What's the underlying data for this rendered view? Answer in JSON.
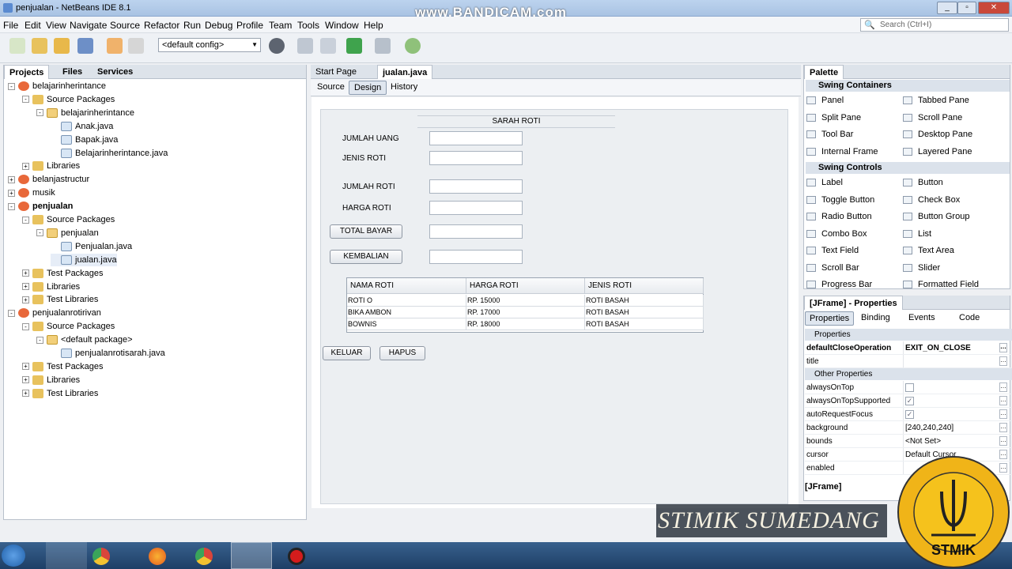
{
  "window": {
    "title": "penjualan - NetBeans IDE 8.1",
    "recorder_watermark": "www.BANDICAM.com",
    "controls": [
      "_",
      "▫",
      "✕"
    ]
  },
  "menu": [
    "File",
    "Edit",
    "View",
    "Navigate",
    "Source",
    "Refactor",
    "Run",
    "Debug",
    "Profile",
    "Team",
    "Tools",
    "Window",
    "Help"
  ],
  "search": {
    "placeholder": "Search (Ctrl+I)"
  },
  "toolbar": {
    "config": "<default config>"
  },
  "projects_panel": {
    "tabs": [
      "Projects",
      "Files",
      "Services"
    ],
    "tree": [
      {
        "label": "belajarinherintance",
        "level": 0,
        "icon": "project",
        "exp": "-"
      },
      {
        "label": "Source Packages",
        "level": 1,
        "icon": "folder",
        "exp": "-"
      },
      {
        "label": "belajarinherintance",
        "level": 2,
        "icon": "package",
        "exp": "-"
      },
      {
        "label": "Anak.java",
        "level": 3,
        "icon": "java"
      },
      {
        "label": "Bapak.java",
        "level": 3,
        "icon": "java"
      },
      {
        "label": "Belajarinherintance.java",
        "level": 3,
        "icon": "java"
      },
      {
        "label": "Libraries",
        "level": 1,
        "icon": "library",
        "exp": "+"
      },
      {
        "label": "belanjastructur",
        "level": 0,
        "icon": "project",
        "exp": "+"
      },
      {
        "label": "musik",
        "level": 0,
        "icon": "project",
        "exp": "+"
      },
      {
        "label": "penjualan",
        "level": 0,
        "icon": "project",
        "exp": "-",
        "bold": true
      },
      {
        "label": "Source Packages",
        "level": 1,
        "icon": "folder",
        "exp": "-"
      },
      {
        "label": "penjualan",
        "level": 2,
        "icon": "package",
        "exp": "-"
      },
      {
        "label": "Penjualan.java",
        "level": 3,
        "icon": "java"
      },
      {
        "label": "jualan.java",
        "level": 3,
        "icon": "java",
        "selected": true
      },
      {
        "label": "Test Packages",
        "level": 1,
        "icon": "folder",
        "exp": "+"
      },
      {
        "label": "Libraries",
        "level": 1,
        "icon": "library",
        "exp": "+"
      },
      {
        "label": "Test Libraries",
        "level": 1,
        "icon": "library",
        "exp": "+"
      },
      {
        "label": "penjualanrotirivan",
        "level": 0,
        "icon": "project",
        "exp": "-"
      },
      {
        "label": "Source Packages",
        "level": 1,
        "icon": "folder",
        "exp": "-"
      },
      {
        "label": "<default package>",
        "level": 2,
        "icon": "package",
        "exp": "-"
      },
      {
        "label": "penjualanrotisarah.java",
        "level": 3,
        "icon": "java"
      },
      {
        "label": "Test Packages",
        "level": 1,
        "icon": "folder",
        "exp": "+"
      },
      {
        "label": "Libraries",
        "level": 1,
        "icon": "library",
        "exp": "+"
      },
      {
        "label": "Test Libraries",
        "level": 1,
        "icon": "library",
        "exp": "+"
      }
    ]
  },
  "editor": {
    "tabs": [
      "Start Page",
      "jualan.java"
    ],
    "modes": [
      "Source",
      "Design",
      "History"
    ],
    "form": {
      "title": "SARAH ROTI",
      "labels": [
        "JUMLAH UANG",
        "JENIS ROTI",
        "JUMLAH ROTI",
        "HARGA ROTI"
      ],
      "button_total": "TOTAL BAYAR",
      "button_kembalian": "KEMBALIAN",
      "button_keluar": "KELUAR",
      "button_hapus": "HAPUS",
      "table": {
        "columns": [
          "NAMA ROTI",
          "HARGA ROTI",
          "JENIS ROTI"
        ],
        "rows": [
          [
            "ROTI O",
            "RP. 15000",
            "ROTI BASAH"
          ],
          [
            "BIKA AMBON",
            "RP. 17000",
            "ROTI BASAH"
          ],
          [
            "BOWNIS",
            "RP. 18000",
            "ROTI BASAH"
          ]
        ]
      }
    }
  },
  "palette": {
    "title": "Palette",
    "sections": [
      {
        "name": "Swing Containers",
        "items": [
          "Panel",
          "Tabbed Pane",
          "Split Pane",
          "Scroll Pane",
          "Tool Bar",
          "Desktop Pane",
          "Internal Frame",
          "Layered Pane"
        ]
      },
      {
        "name": "Swing Controls",
        "items": [
          "Label",
          "Button",
          "Toggle Button",
          "Check Box",
          "Radio Button",
          "Button Group",
          "Combo Box",
          "List",
          "Text Field",
          "Text Area",
          "Scroll Bar",
          "Slider",
          "Progress Bar",
          "Formatted Field"
        ]
      }
    ]
  },
  "properties": {
    "title": "[JFrame] - Properties",
    "tabs": [
      "Properties",
      "Binding",
      "Events",
      "Code"
    ],
    "cat1": "Properties",
    "rows1": [
      {
        "k": "defaultCloseOperation",
        "v": "EXIT_ON_CLOSE",
        "bold": true
      },
      {
        "k": "title",
        "v": ""
      }
    ],
    "cat2": "Other Properties",
    "rows2": [
      {
        "k": "alwaysOnTop",
        "v": "",
        "check": "off"
      },
      {
        "k": "alwaysOnTopSupported",
        "v": "",
        "check": "on"
      },
      {
        "k": "autoRequestFocus",
        "v": "",
        "check": "on"
      },
      {
        "k": "background",
        "v": "[240,240,240]"
      },
      {
        "k": "bounds",
        "v": "<Not Set>"
      },
      {
        "k": "cursor",
        "v": "Default Cursor"
      },
      {
        "k": "enabled",
        "v": ""
      }
    ],
    "footer": "[JFrame]"
  },
  "overlay": {
    "text": "STIMIK SUMEDANG",
    "logo_ring": "SEKOLAH TINGGI MANAJEMEN INFORMATIKA & KOMPUTER",
    "logo_city": "SUMEDANG",
    "logo_name": "STMIK"
  }
}
